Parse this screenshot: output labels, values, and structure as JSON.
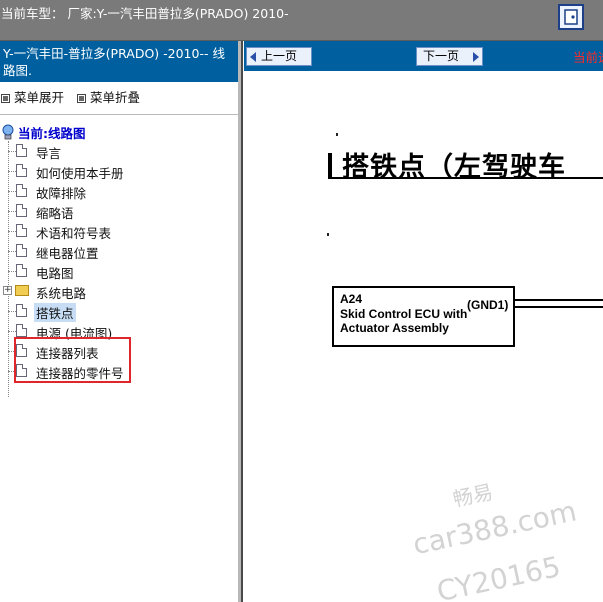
{
  "topbar": {
    "title": "当前车型： 厂家:Y-一汽丰田普拉多(PRADO) 2010-",
    "exit_icon": "exit-door-icon"
  },
  "sidebar": {
    "header_title": "Y-一汽丰田-普拉多(PRADO) -2010-- 线路图.",
    "expand_label": "菜单展开",
    "collapse_label": "菜单折叠",
    "tree": {
      "root_label": "当前:线路图",
      "items": [
        {
          "label": "导言",
          "type": "doc"
        },
        {
          "label": "如何使用本手册",
          "type": "doc"
        },
        {
          "label": "故障排除",
          "type": "doc"
        },
        {
          "label": "缩略语",
          "type": "doc"
        },
        {
          "label": "术语和符号表",
          "type": "doc"
        },
        {
          "label": "继电器位置",
          "type": "doc"
        },
        {
          "label": "电路图",
          "type": "doc"
        },
        {
          "label": "系统电路",
          "type": "folder"
        },
        {
          "label": "搭铁点",
          "type": "doc",
          "selected": true
        },
        {
          "label": "电源 (电流图)",
          "type": "doc"
        },
        {
          "label": "连接器列表",
          "type": "doc"
        },
        {
          "label": "连接器的零件号",
          "type": "doc"
        }
      ]
    }
  },
  "main": {
    "prev_label": "上一页",
    "next_label": "下一页",
    "status_text": "当前选",
    "document": {
      "title": "搭铁点（左驾驶车",
      "component_code": "A24",
      "component_name": "Skid Control ECU with Actuator Assembly",
      "pin_label": "(GND1)",
      "watermark_cn": "畅易",
      "watermark_site": "car388.com",
      "watermark_id": "CY20165"
    }
  },
  "colors": {
    "header_blue": "#00609f",
    "highlight_red": "#e0262b",
    "status_red": "#ff2a2a",
    "tree_root_blue": "#0000cc"
  }
}
